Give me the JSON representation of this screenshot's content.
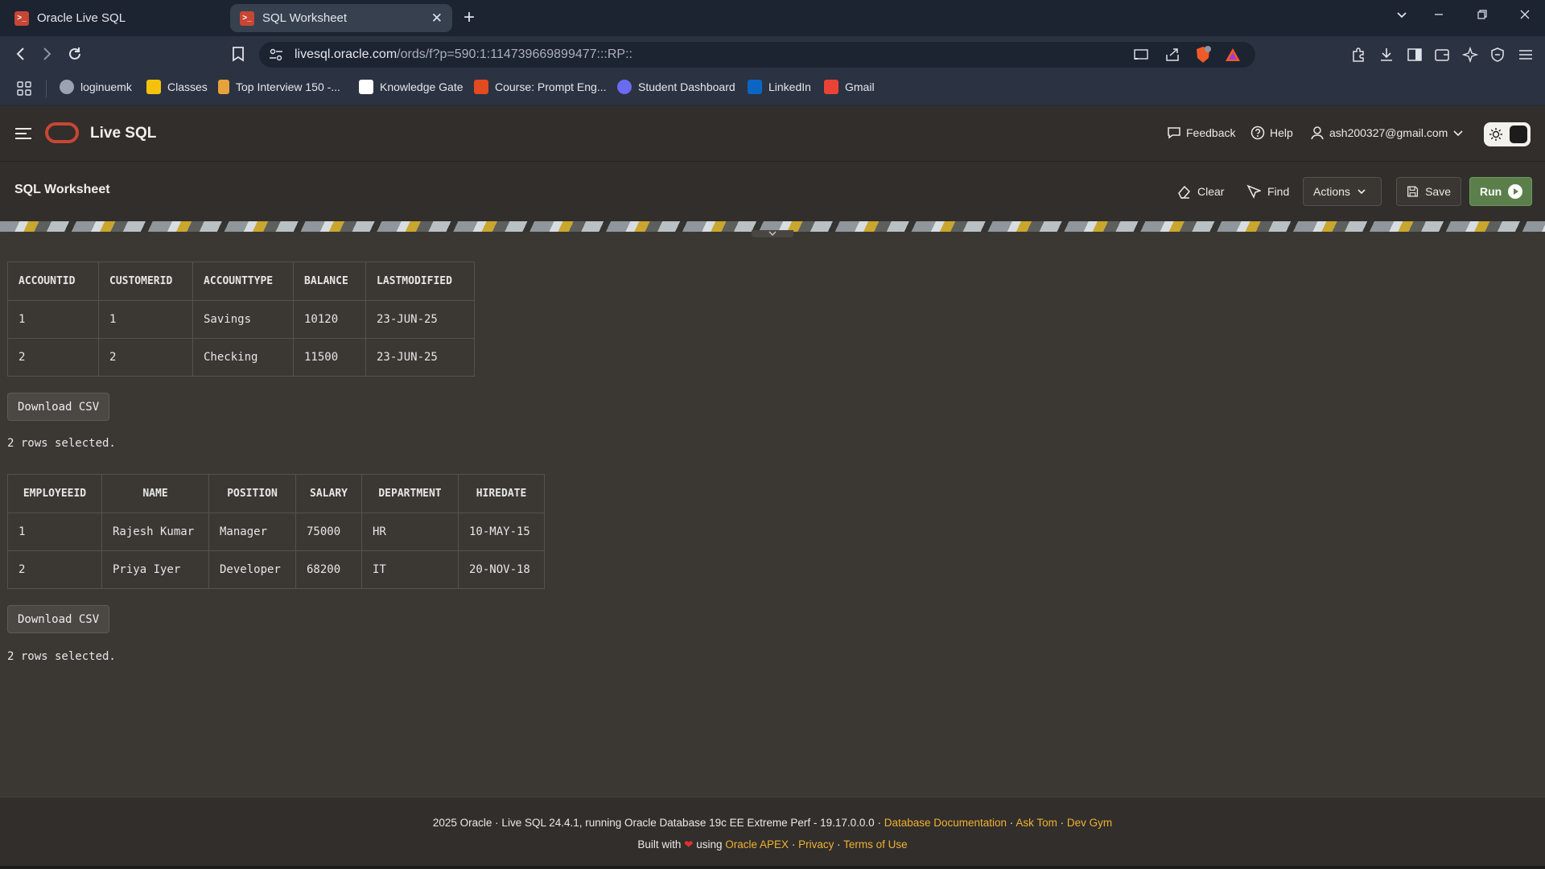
{
  "browser": {
    "tabs": [
      {
        "title": "Oracle Live SQL",
        "active": false
      },
      {
        "title": "SQL Worksheet",
        "active": true
      }
    ],
    "url_host": "livesql.oracle.com",
    "url_path": "/ords/f?p=590:1:114739669899477:::RP::",
    "bookmarks": [
      {
        "label": "loginuemk",
        "icon": "globe-icon",
        "color": "#9aa3b2"
      },
      {
        "label": "Classes",
        "icon": "classroom-icon",
        "color": "#f4c20d"
      },
      {
        "label": "Top Interview 150 -...",
        "icon": "leetcode-icon",
        "color": "#e8a23b"
      },
      {
        "label": "Knowledge Gate",
        "icon": "kg-icon",
        "color": "#ffffff"
      },
      {
        "label": "Course: Prompt Eng...",
        "icon": "course-icon",
        "color": "#e24a20"
      },
      {
        "label": "Student Dashboard",
        "icon": "dashboard-icon",
        "color": "#6b6bf2"
      },
      {
        "label": "LinkedIn",
        "icon": "linkedin-icon",
        "color": "#0a66c2"
      },
      {
        "label": "Gmail",
        "icon": "gmail-icon",
        "color": "#ea4335"
      }
    ]
  },
  "app": {
    "name": "Live SQL",
    "feedback_label": "Feedback",
    "help_label": "Help",
    "user_email": "ash200327@gmail.com",
    "brand_color": "#c74634"
  },
  "worksheet": {
    "title": "SQL Worksheet",
    "clear_label": "Clear",
    "find_label": "Find",
    "actions_label": "Actions",
    "save_label": "Save",
    "run_label": "Run"
  },
  "results": [
    {
      "columns": [
        "ACCOUNTID",
        "CUSTOMERID",
        "ACCOUNTTYPE",
        "BALANCE",
        "LASTMODIFIED"
      ],
      "rows": [
        [
          "1",
          "1",
          "Savings",
          "10120",
          "23-JUN-25"
        ],
        [
          "2",
          "2",
          "Checking",
          "11500",
          "23-JUN-25"
        ]
      ],
      "download_label": "Download CSV",
      "status": "2 rows selected."
    },
    {
      "columns": [
        "EMPLOYEEID",
        "NAME",
        "POSITION",
        "SALARY",
        "DEPARTMENT",
        "HIREDATE"
      ],
      "rows": [
        [
          "1",
          "Rajesh Kumar",
          "Manager",
          "75000",
          "HR",
          "10-MAY-15"
        ],
        [
          "2",
          "Priya Iyer",
          "Developer",
          "68200",
          "IT",
          "20-NOV-18"
        ]
      ],
      "download_label": "Download CSV",
      "status": "2 rows selected."
    }
  ],
  "footer": {
    "line1_text": "2025 Oracle · Live SQL 24.4.1, running Oracle Database 19c EE Extreme Perf - 19.17.0.0.0 · ",
    "doc_link": "Database Documentation",
    "sep": " · ",
    "asktom_link": "Ask Tom",
    "devgym_link": "Dev Gym",
    "built_with": "Built with",
    "using": "using",
    "apex_link": "Oracle APEX",
    "privacy_link": "Privacy",
    "terms_link": "Terms of Use"
  }
}
